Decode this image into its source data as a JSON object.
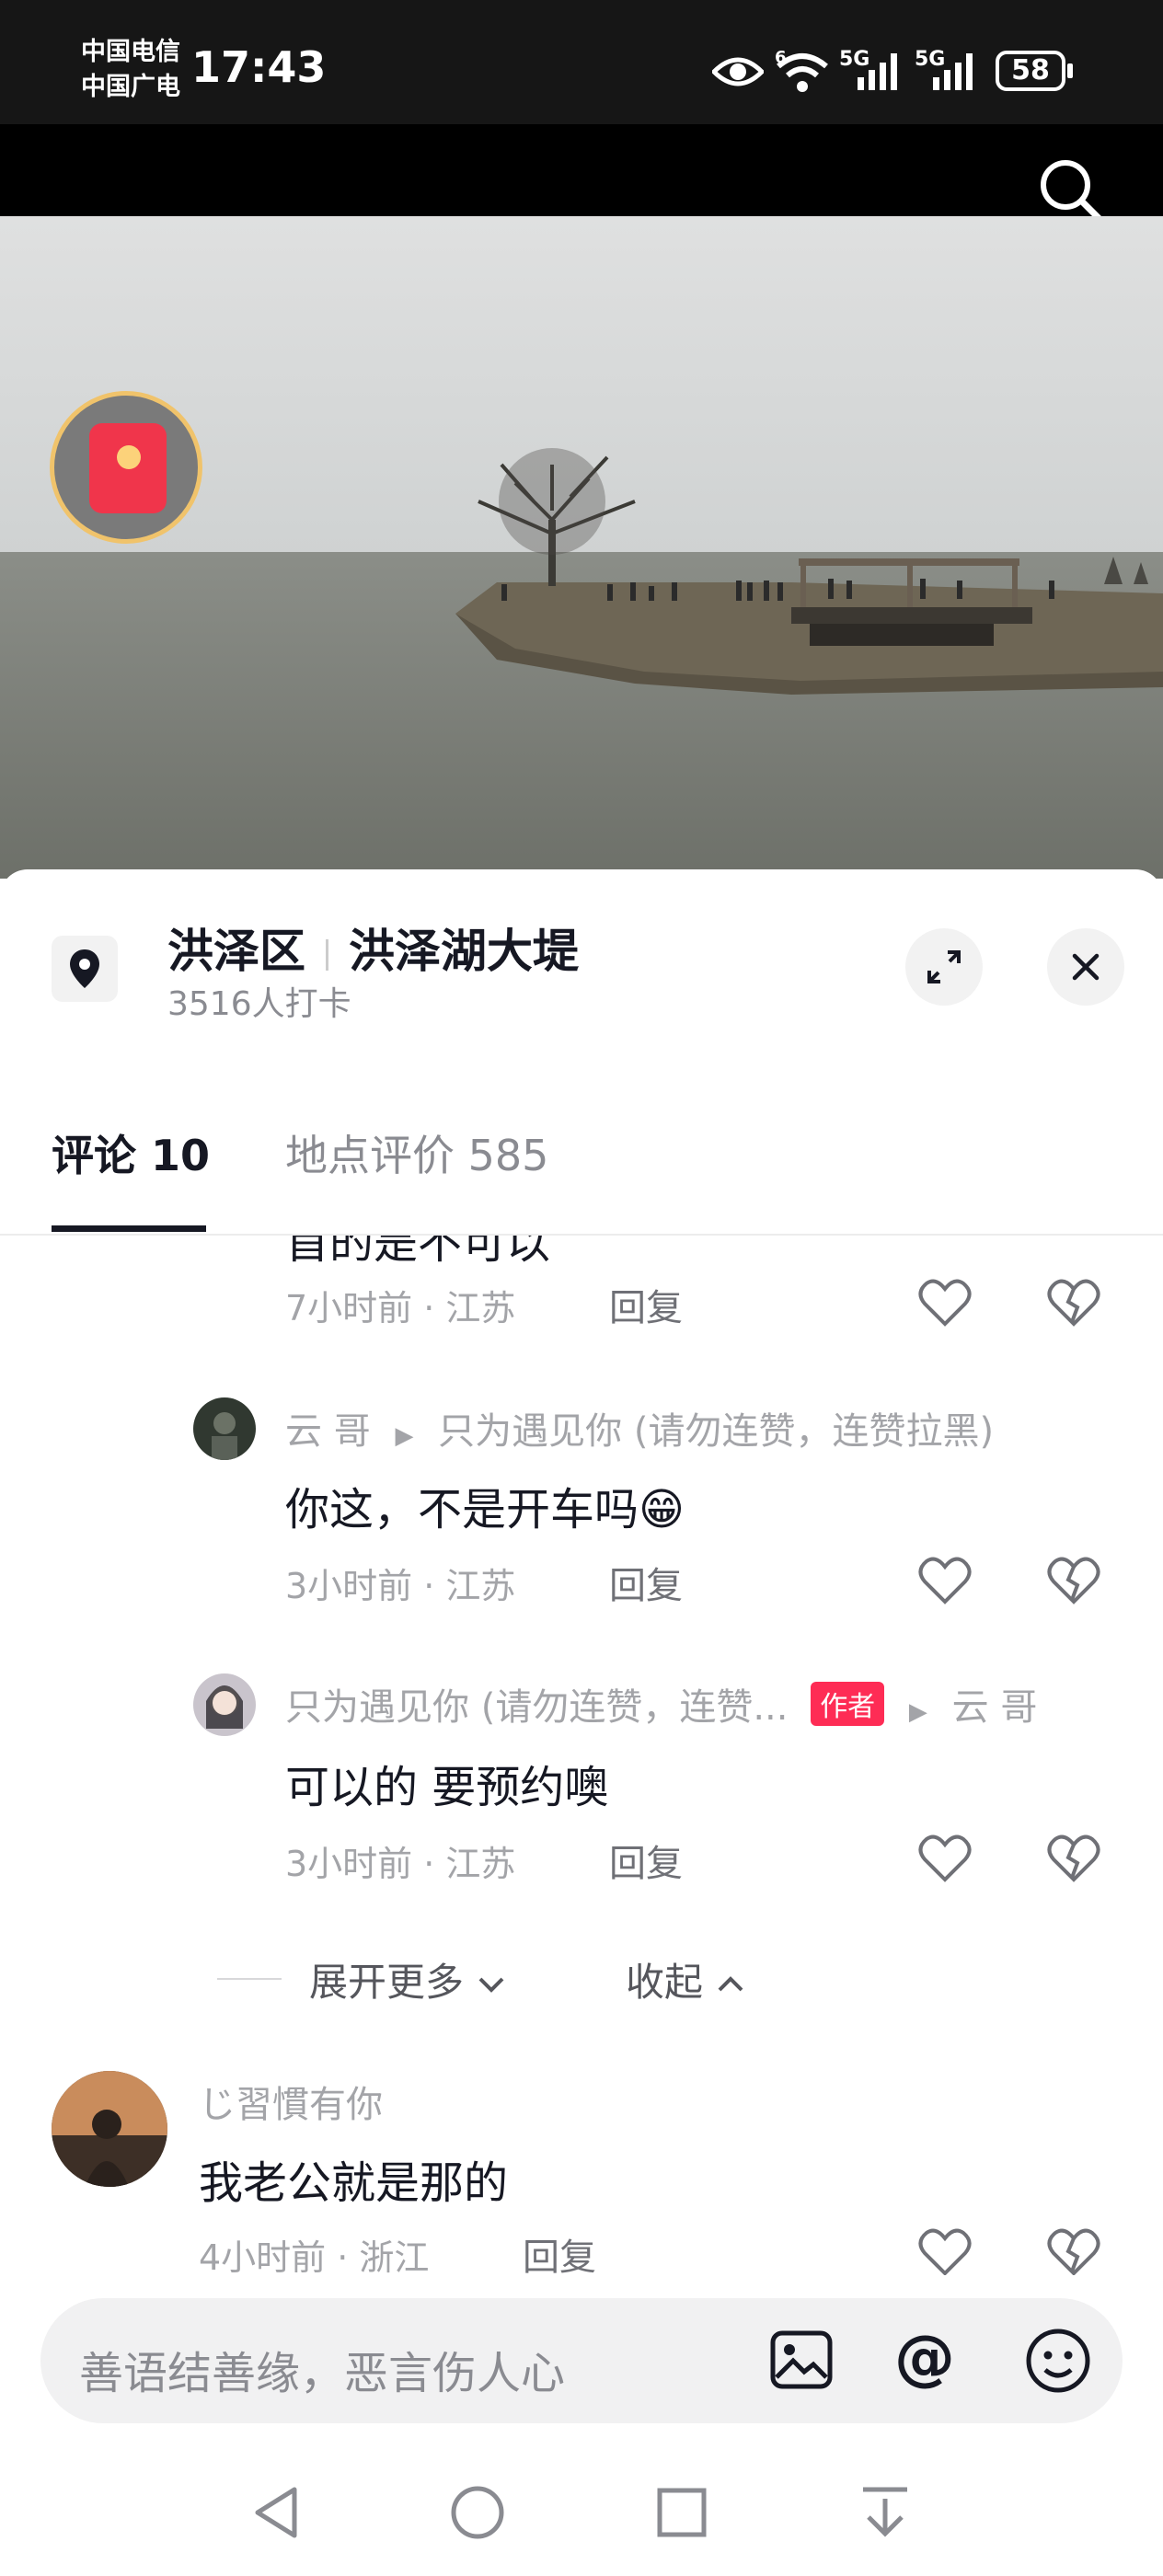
{
  "status_bar": {
    "carrier1": "中国电信",
    "carrier2": "中国广电",
    "time": "17:43",
    "signal1": "5G",
    "signal2": "5G",
    "battery": "58",
    "wifi_tag": "6"
  },
  "location": {
    "district": "洪泽区",
    "place": "洪泽湖大堤",
    "checkins": "3516人打卡"
  },
  "tabs": [
    {
      "label": "评论 10",
      "active": true
    },
    {
      "label": "地点评价 585",
      "active": false
    }
  ],
  "comments": [
    {
      "partial_text": "首的是不可以",
      "meta": "7小时前 · 江苏",
      "reply_label": "回复"
    },
    {
      "user": "云 哥",
      "reply_to": "只为遇见你 (请勿连赞，连赞拉黑)",
      "text": "你这，不是开车吗😁",
      "meta": "3小时前 · 江苏",
      "reply_label": "回复"
    },
    {
      "user": "只为遇见你 (请勿连赞，连赞...",
      "badge": "作者",
      "reply_to": "云 哥",
      "text": "可以的 要预约噢",
      "meta": "3小时前 · 江苏",
      "reply_label": "回复"
    },
    {
      "user": "じ習慣有你",
      "text": "我老公就是那的",
      "meta": "4小时前 · 浙江",
      "reply_label": "回复"
    }
  ],
  "expand": {
    "more": "展开更多",
    "collapse": "收起"
  },
  "input": {
    "placeholder": "善语结善缘，恶言伤人心"
  },
  "colors": {
    "accent": "#161823",
    "badge": "#fe2c55",
    "sheet_bg": "#ffffff"
  }
}
